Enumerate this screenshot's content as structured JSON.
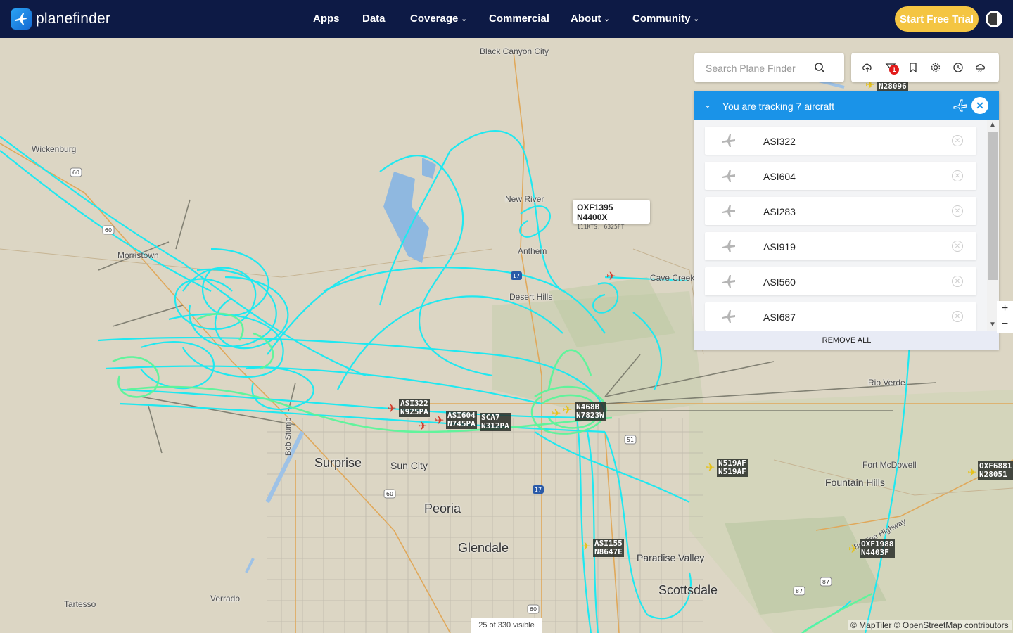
{
  "brand": {
    "name": "planefinder"
  },
  "nav": {
    "items": [
      {
        "label": "Apps",
        "dropdown": false
      },
      {
        "label": "Data",
        "dropdown": false
      },
      {
        "label": "Coverage",
        "dropdown": true
      },
      {
        "label": "Commercial",
        "dropdown": false
      },
      {
        "label": "About",
        "dropdown": true
      },
      {
        "label": "Community",
        "dropdown": true
      }
    ],
    "trial_button": "Start Free Trial"
  },
  "search": {
    "placeholder": "Search Plane Finder"
  },
  "toolbar": {
    "icons": [
      "upload-icon",
      "filter-icon",
      "bookmark-icon",
      "settings-icon",
      "history-icon",
      "weather-icon"
    ],
    "filter_badge": "1"
  },
  "tracking": {
    "title": "You are tracking 7 aircraft",
    "aircraft": [
      "ASI322",
      "ASI604",
      "ASI283",
      "ASI919",
      "ASI560",
      "ASI687"
    ],
    "remove_all": "REMOVE ALL"
  },
  "popup": {
    "title": "OXF1395 N4400X",
    "subtitle": "111KTS, 6325FT"
  },
  "map": {
    "places": [
      {
        "name": "Black Canyon City",
        "size": "small"
      },
      {
        "name": "Wickenburg",
        "size": "small"
      },
      {
        "name": "Morristown",
        "size": "small"
      },
      {
        "name": "New River",
        "size": "small"
      },
      {
        "name": "Anthem",
        "size": "small"
      },
      {
        "name": "Cave Creek",
        "size": "small"
      },
      {
        "name": "Desert Hills",
        "size": "small"
      },
      {
        "name": "Rio Verde",
        "size": "small"
      },
      {
        "name": "Fort McDowell",
        "size": "small"
      },
      {
        "name": "Fountain Hills",
        "size": "mid"
      },
      {
        "name": "Surprise",
        "size": "big"
      },
      {
        "name": "Sun City",
        "size": "mid"
      },
      {
        "name": "Peoria",
        "size": "big"
      },
      {
        "name": "Glendale",
        "size": "big"
      },
      {
        "name": "Paradise Valley",
        "size": "mid"
      },
      {
        "name": "Scottsdale",
        "size": "big"
      },
      {
        "name": "Tartesso",
        "size": "small"
      },
      {
        "name": "Verrado",
        "size": "small"
      },
      {
        "name": "Bob Stump",
        "size": "small"
      },
      {
        "name": "Beeline Highway",
        "size": "small"
      }
    ],
    "flight_labels": [
      {
        "line1": "ASI322",
        "line2": "N925PA"
      },
      {
        "line1": "ASI604",
        "line2": "N745PA"
      },
      {
        "line1": "SCA7",
        "line2": "N312PA"
      },
      {
        "line1": "N468B",
        "line2": "N7823W"
      },
      {
        "line1": "N519AF",
        "line2": "N519AF"
      },
      {
        "line1": "OXF6881",
        "line2": "N28051"
      },
      {
        "line1": "ASI155",
        "line2": "N8647E"
      },
      {
        "line1": "OXF1988",
        "line2": "N4403F"
      },
      {
        "line1": "N28096",
        "line2": ""
      }
    ],
    "highway_shields": [
      "60",
      "60",
      "17",
      "17",
      "51",
      "60",
      "87",
      "87",
      "60"
    ],
    "visible_count": "25 of 330 visible",
    "attribution": "© MapTiler © OpenStreetMap contributors",
    "track_color": "#1fe8f0",
    "selected_track_color": "#5bf59a"
  }
}
